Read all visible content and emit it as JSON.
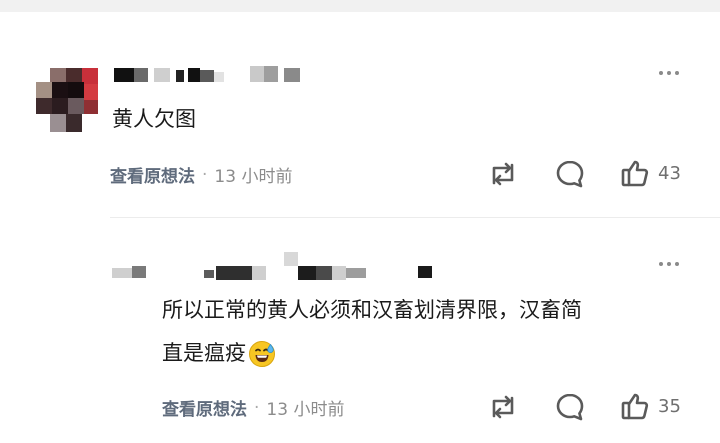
{
  "comments": [
    {
      "text": "黄人欠图",
      "meta_link": "查看原想法",
      "time": "13 小时前",
      "likes": "43"
    },
    {
      "text_line1": "所以正常的黄人必须和汉畜划清界限，汉畜简",
      "text_line2": "直是瘟疫",
      "emoji_icon": "sweat-smile-icon",
      "meta_link": "查看原想法",
      "time": "13 小时前",
      "likes": "35"
    }
  ],
  "meta_separator": "·",
  "colors": {
    "icon": "#5a5a5a",
    "meta": "#8c8c8c",
    "link": "#5f6b7c"
  }
}
